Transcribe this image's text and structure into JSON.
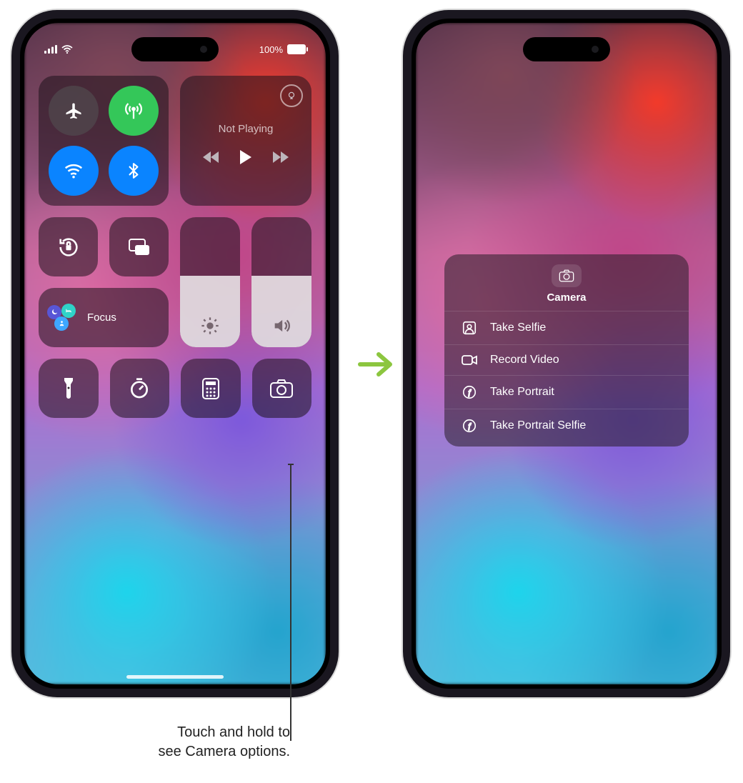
{
  "status": {
    "batteryText": "100%"
  },
  "media": {
    "nowPlaying": "Not Playing"
  },
  "focus": {
    "label": "Focus"
  },
  "sliders": {
    "brightnessPct": 55,
    "volumePct": 55
  },
  "callout": {
    "line1": "Touch and hold to",
    "line2": "see Camera options."
  },
  "cameraMenu": {
    "title": "Camera",
    "items": [
      {
        "label": "Take Selfie"
      },
      {
        "label": "Record Video"
      },
      {
        "label": "Take Portrait"
      },
      {
        "label": "Take Portrait Selfie"
      }
    ]
  }
}
